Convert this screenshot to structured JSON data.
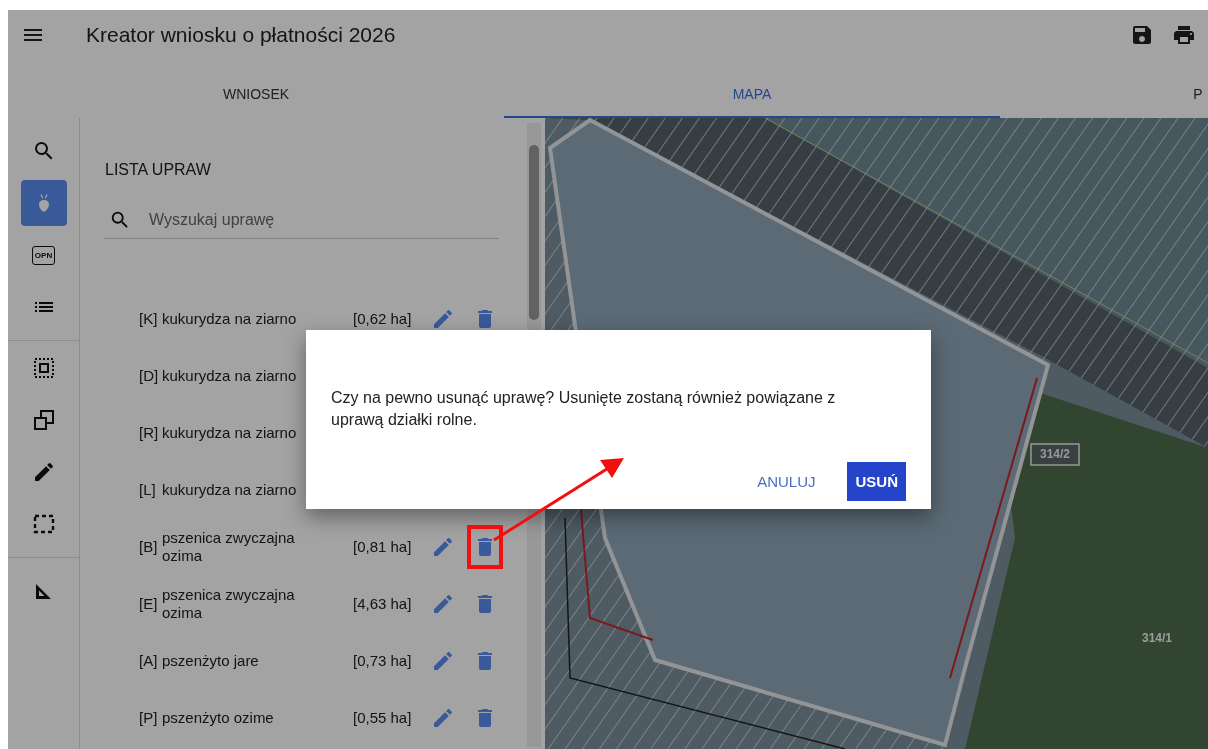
{
  "header": {
    "title": "Kreator wniosku o płatności 2026"
  },
  "tabs": [
    {
      "label": "WNIOSEK",
      "selected": false
    },
    {
      "label": "MAPA",
      "selected": true
    },
    {
      "label": "P",
      "selected": false
    }
  ],
  "rail_groups": [
    {
      "items": [
        {
          "kind": "search",
          "selected": false
        },
        {
          "kind": "crop",
          "selected": true
        },
        {
          "kind": "badge",
          "label": "OPN",
          "selected": false
        },
        {
          "kind": "list",
          "selected": false
        }
      ]
    },
    {
      "items": [
        {
          "kind": "select",
          "selected": false
        },
        {
          "kind": "copy",
          "selected": false
        },
        {
          "kind": "edit",
          "selected": false
        },
        {
          "kind": "frame",
          "selected": false
        }
      ]
    },
    {
      "items": [
        {
          "kind": "measure",
          "selected": false
        }
      ]
    }
  ],
  "panel": {
    "title": "LISTA UPRAW",
    "search": {
      "placeholder": "Wyszukaj uprawę"
    },
    "crops": [
      {
        "code": "[K]",
        "name": "kukurydza na ziarno",
        "area": "[0,62 ha]",
        "marked": false
      },
      {
        "code": "[D]",
        "name": "kukurydza na ziarno"
      },
      {
        "code": "[R]",
        "name": "kukurydza na ziarno"
      },
      {
        "code": "[L]",
        "name": "kukurydza na ziarno"
      },
      {
        "code": "[B]",
        "name": "pszenica zwyczajna ozima",
        "area": "[0,81 ha]",
        "marked": true
      },
      {
        "code": "[E]",
        "name": "pszenica zwyczajna ozima",
        "area": "[4,63 ha]",
        "marked": false
      },
      {
        "code": "[A]",
        "name": "pszenżyto jare",
        "area": "[0,73 ha]",
        "marked": false
      },
      {
        "code": "[P]",
        "name": "pszenżyto ozime",
        "area": "[0,55 ha]",
        "marked": false
      }
    ]
  },
  "map": {
    "parcel_labels": [
      {
        "text": "314/2",
        "kind": "boxed"
      },
      {
        "text": "314/1",
        "kind": "plain"
      }
    ]
  },
  "dialog": {
    "message": "Czy na pewno usunąć uprawę? Usunięte zostaną również powiązane z uprawą działki rolne.",
    "buttons": [
      {
        "label": "ANULUJ",
        "kind": "text"
      },
      {
        "label": "USUŃ",
        "kind": "primary"
      }
    ]
  }
}
